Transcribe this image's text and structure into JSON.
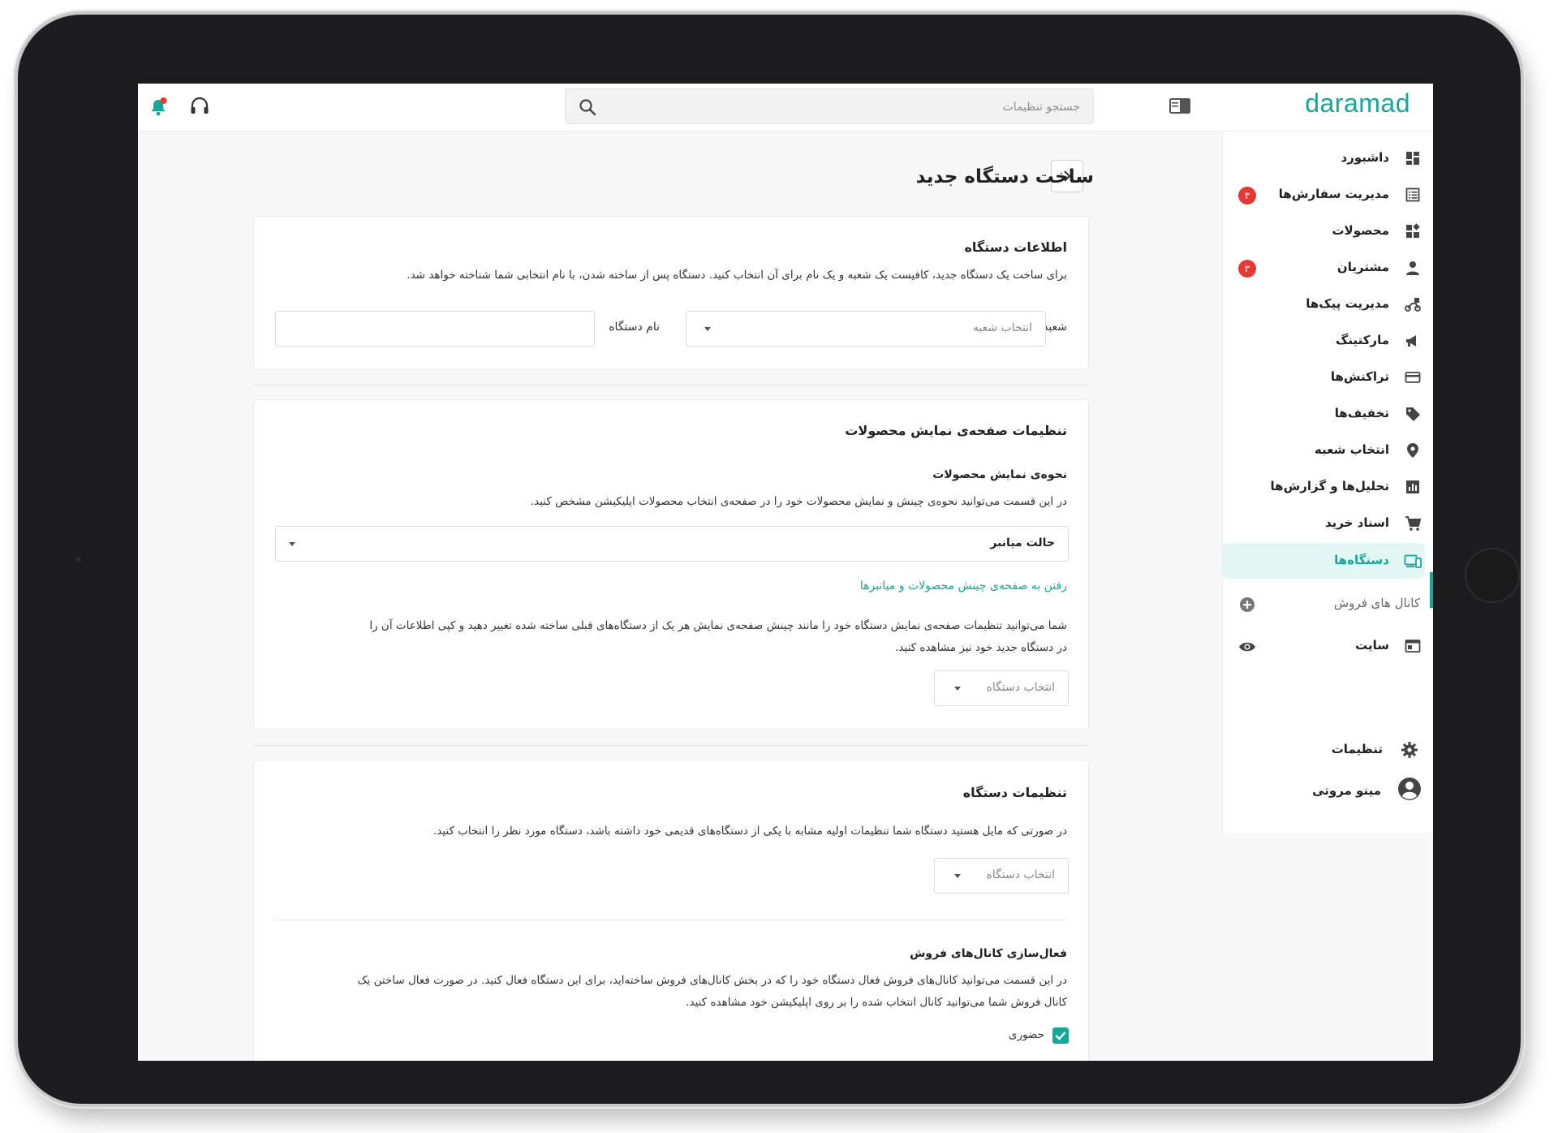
{
  "topbar": {
    "logo": "daramad",
    "search_placeholder": "جستجو تنظیمات"
  },
  "sidebar": {
    "items": [
      {
        "label": "داشبورد",
        "icon": "dashboard-icon"
      },
      {
        "label": "مدیریت سفارش‌ها",
        "icon": "orders-icon",
        "badge": "۳"
      },
      {
        "label": "محصولات",
        "icon": "products-icon"
      },
      {
        "label": "مشتریان",
        "icon": "customers-icon",
        "badge": "۳"
      },
      {
        "label": "مدیریت پیک‌ها",
        "icon": "delivery-icon"
      },
      {
        "label": "مارکتینگ",
        "icon": "megaphone-icon"
      },
      {
        "label": "تراکنش‌ها",
        "icon": "card-icon"
      },
      {
        "label": "تخفیف‌ها",
        "icon": "tag-icon"
      },
      {
        "label": "انتخاب شعبه",
        "icon": "location-icon"
      },
      {
        "label": "تحلیل‌ها و گزارش‌ها",
        "icon": "chart-icon"
      },
      {
        "label": "اسناد خرید",
        "icon": "cart-icon"
      },
      {
        "label": "دستگاه‌ها",
        "icon": "devices-icon",
        "active": true
      },
      {
        "label": "کانال های فروش",
        "icon": "plus-circle-icon"
      },
      {
        "label": "سایت",
        "icon": "site-icon"
      }
    ],
    "settings_label": "تنظیمات",
    "user_name": "مینو مروتی"
  },
  "page": {
    "title": "ساخت دستگاه جدید"
  },
  "device_info": {
    "title": "اطلاعات دستگاه",
    "description": "برای ساخت یک دستگاه جدید، کافیست یک شعبه و یک نام برای آن انتخاب کنید. دستگاه پس از ساخته شدن، با نام انتخابی شما شناخته خواهد شد.",
    "branch_label": "شعبه",
    "branch_placeholder": "انتخاب شعبه",
    "name_label": "نام دستگاه",
    "name_value": ""
  },
  "display_settings": {
    "title": "تنظیمات صفحه‌ی نمایش محصولات",
    "subtitle": "نحوه‌ی نمایش محصولات",
    "description": "در این قسمت می‌توانید نحوه‌ی چینش و نمایش محصولات خود را در صفحه‌ی انتخاب محصولات اپلیکیشن مشخص کنید.",
    "mode_value": "حالت میانبر",
    "link": "رفتن به صفحه‌ی چینش محصولات و میانبرها",
    "copy_line1": "شما می‌توانید تنظیمات صفحه‌ی نمایش دستگاه خود را مانند چینش صفحه‌ی نمایش هر یک از دستگاه‌های قبلی ساخته شده تغییر دهید و کپی اطلاعات آن را",
    "copy_line2": "در دستگاه جدید خود نیز مشاهده کنید.",
    "device_select": "انتخاب دستگاه"
  },
  "device_settings": {
    "title": "تنظیمات دستگاه",
    "description": "در صورتی که مایل هستید دستگاه شما تنظیمات اولیه مشابه با یکی از دستگاه‌های قدیمی خود داشته باشد، دستگاه مورد نظر را انتخاب کنید.",
    "device_select": "انتخاب دستگاه",
    "channels_title": "فعال‌سازی کانال‌های فروش",
    "channels_line1": "در این قسمت می‌توانید کانال‌های فروش فعال دستگاه خود را که در بخش کانال‌های فروش ساخته‌اید، برای این دستگاه فعال کنید. در صورت فعال ساختن یک",
    "channels_line2": "کانال فروش شما می‌توانید کانال انتخاب شده را بر روی اپلیکیشن خود مشاهده کنید.",
    "channel_inperson": "حضوری",
    "channel_inperson_checked": true
  },
  "colors": {
    "accent": "#14a79a",
    "badge": "#e53935"
  }
}
